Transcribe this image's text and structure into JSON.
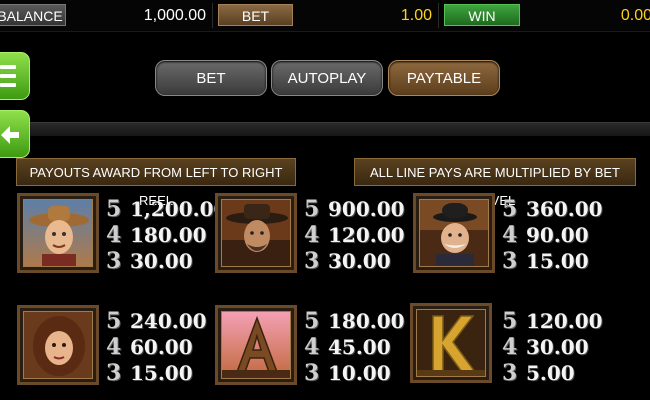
{
  "topbar": {
    "balance_label": "BALANCE",
    "balance_value": "1,000.00",
    "bet_label": "BET",
    "bet_value": "1.00",
    "win_label": "WIN",
    "win_value": "0.00"
  },
  "side": {
    "menu_icon": "hamburger-icon",
    "back_icon": "back-arrow-icon"
  },
  "tabs": [
    {
      "label": "BET",
      "active": false
    },
    {
      "label": "AUTOPLAY",
      "active": false
    },
    {
      "label": "PAYTABLE",
      "active": true
    }
  ],
  "banners": {
    "left": "PAYOUTS AWARD FROM LEFT TO RIGHT REEL",
    "right": "ALL LINE PAYS ARE MULTIPLIED BY BET LEVEL"
  },
  "symbols": [
    {
      "name": "cowboy",
      "pays": [
        {
          "count": "5",
          "value": "1,200.00"
        },
        {
          "count": "4",
          "value": "180.00"
        },
        {
          "count": "3",
          "value": "30.00"
        }
      ]
    },
    {
      "name": "bandit",
      "pays": [
        {
          "count": "5",
          "value": "900.00"
        },
        {
          "count": "4",
          "value": "120.00"
        },
        {
          "count": "3",
          "value": "30.00"
        }
      ]
    },
    {
      "name": "sheriff",
      "pays": [
        {
          "count": "5",
          "value": "360.00"
        },
        {
          "count": "4",
          "value": "90.00"
        },
        {
          "count": "3",
          "value": "15.00"
        }
      ]
    },
    {
      "name": "lady",
      "pays": [
        {
          "count": "5",
          "value": "240.00"
        },
        {
          "count": "4",
          "value": "60.00"
        },
        {
          "count": "3",
          "value": "15.00"
        }
      ]
    },
    {
      "name": "ace",
      "pays": [
        {
          "count": "5",
          "value": "180.00"
        },
        {
          "count": "4",
          "value": "45.00"
        },
        {
          "count": "3",
          "value": "10.00"
        }
      ]
    },
    {
      "name": "king",
      "pays": [
        {
          "count": "5",
          "value": "120.00"
        },
        {
          "count": "4",
          "value": "30.00"
        },
        {
          "count": "3",
          "value": "5.00"
        }
      ]
    }
  ],
  "colors": {
    "accent_gold": "#ffd21e",
    "win_green": "#3fa43f",
    "bet_brown": "#8a6a44",
    "banner_brown": "#5a4220"
  }
}
